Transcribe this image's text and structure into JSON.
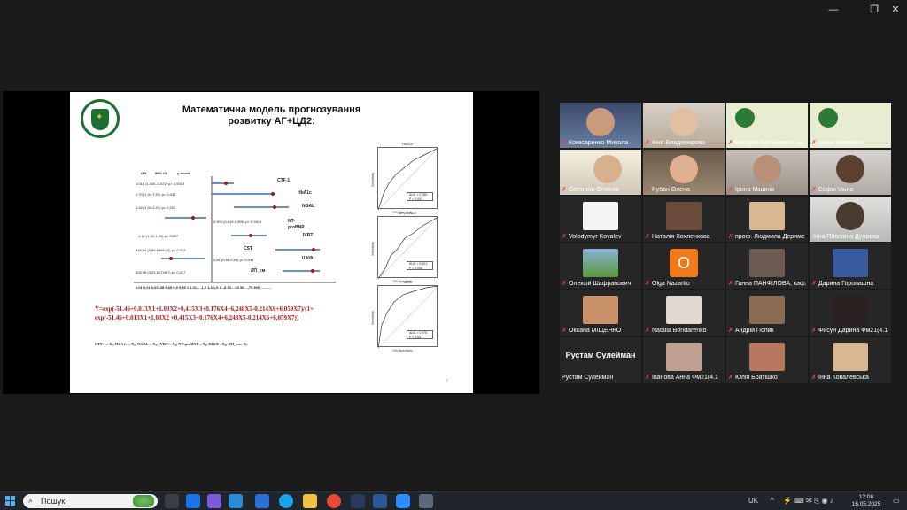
{
  "window": {
    "controls": [
      "—",
      "❐",
      "✕"
    ]
  },
  "slide": {
    "title_line1": "Математична модель прогнозування",
    "title_line2": "розвитку АГ+ЦД2:",
    "forest": {
      "header": [
        "OR",
        "95% CI",
        "p-levele"
      ],
      "rows": [
        {
          "stat": "1,013 (1,004–1,022) p= 0,0013",
          "label": "CTF-1"
        },
        {
          "stat": "2,79 (1,04-7,53) p= 0,043",
          "label": "HbA1c"
        },
        {
          "stat": "1,52 (1,04-2,21) p= 0,031",
          "label": "NGAL"
        },
        {
          "stat": "0,904 (0,819-0,996) p= 0,0418",
          "label": "NT-proBNP"
        },
        {
          "stat": "1,19 (1,02-1,39) p= 0,027",
          "label": "IVRT"
        },
        {
          "stat": "516,94 (3,89-6866,12) p= 0,012",
          "label": "CST"
        },
        {
          "stat": "0,81 (0,66-0,99) p= 0,043",
          "label": "ШКФ"
        },
        {
          "stat": "628,38 (3,02-60748,7) p= 0,017",
          "label": "ЛП_см"
        }
      ],
      "axis": "0,01 0,01 0,02..08 0,65 0,9 0,95 1 1,01.....1,2 1,3 1,5 2...8 10....20 30.....70 900 ..........."
    },
    "formula": "Y=exp(-51.46+0.013X1+1.03X2+0,415X3+0.176X4+6,248X5-0.214X6+6,059X7)/(1+ exp(-51.46+0.013X1+1.03X2 +0,415X3+0.176X4+6,248X5-0.214X6+6,059X7))",
    "legend": "CTF-1– X₁, HbA1c – X₂, NGAL – X₃, IVRT – X₄, NT-proBNP – X₅, ШКФ –X₆, ЛП_см– X₇",
    "rocs": [
      {
        "title": "HbA1c",
        "auc": "AUC = 0,785",
        "p": "P < 0,001",
        "xlabel": "100-Specificity",
        "ylabel": "Sensitivity"
      },
      {
        "title": "NT-proBNP",
        "auc": "AUC = 0,821",
        "p": "P = 0,008",
        "xlabel": "100-Specificity",
        "ylabel": "Sensitivity"
      },
      {
        "title": "ШКФ",
        "auc": "AUC = 0,878",
        "p": "P < 0,001",
        "xlabel": "100-Specificity",
        "ylabel": "Sensitivity"
      }
    ],
    "page_number": "7"
  },
  "participants": [
    {
      "name": "Комісаренко Микола"
    },
    {
      "name": "Інна Владимирова"
    },
    {
      "name": "Вікторія Кисличенко, ка"
    },
    {
      "name": "Ірина Журавель"
    },
    {
      "name": "Світлана Олійник"
    },
    {
      "name": "Рубан Олена"
    },
    {
      "name": "Ірина Мішина"
    },
    {
      "name": "Софія Ільна"
    },
    {
      "name": "Volodymyr Kovalev"
    },
    {
      "name": "Наталія Хохленкова"
    },
    {
      "name": "проф. Людмила Дериме"
    },
    {
      "name": "Інна Павлівна Дунаєва"
    },
    {
      "name": "Олексій Шафранович"
    },
    {
      "name": "Olga Nazarko",
      "initial": "O"
    },
    {
      "name": "Ганна ПАНФІЛОВА, каф."
    },
    {
      "name": "Дарина Горопашна"
    },
    {
      "name": "Оксана МІЩЕНКО"
    },
    {
      "name": "Natalia Bondarenko"
    },
    {
      "name": "Андрій Попик"
    },
    {
      "name": "Фисун Дарина Фм21(4.1"
    },
    {
      "name": "Рустам Сулейман",
      "big_name": "Рустам Сулейман"
    },
    {
      "name": "Іванова Анна Фм21(4.1"
    },
    {
      "name": "Юлія Братішко"
    },
    {
      "name": "Інна Ковалевська"
    }
  ],
  "taskbar": {
    "search_placeholder": "Пошук",
    "language": "UK",
    "time": "12:08",
    "date": "16.05.2025"
  }
}
